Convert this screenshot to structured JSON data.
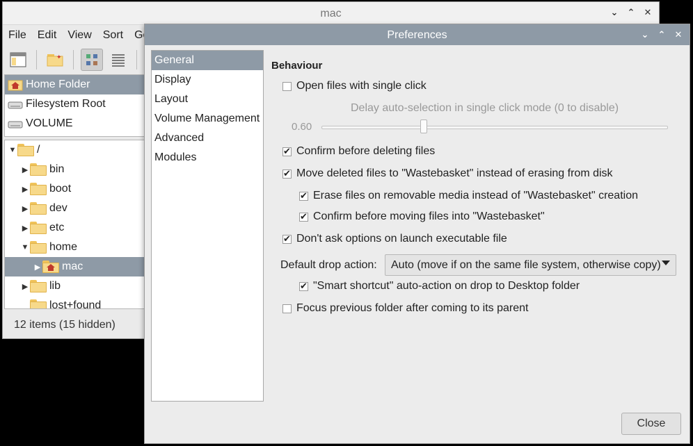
{
  "file_manager": {
    "title": "mac",
    "window_controls": {
      "minimize": "⌄",
      "maximize": "⌃",
      "close": "✕"
    },
    "menu": [
      "File",
      "Edit",
      "View",
      "Sort",
      "Go"
    ],
    "places": [
      {
        "label": "Home Folder",
        "icon": "home-icon",
        "selected": true
      },
      {
        "label": "Filesystem Root",
        "icon": "drive-icon",
        "selected": false
      },
      {
        "label": "VOLUME",
        "icon": "drive-icon",
        "selected": false
      }
    ],
    "tree": [
      {
        "label": "/",
        "expanded": true,
        "level": 0
      },
      {
        "label": "bin",
        "expanded": false,
        "level": 1
      },
      {
        "label": "boot",
        "expanded": false,
        "level": 1
      },
      {
        "label": "dev",
        "expanded": false,
        "level": 1
      },
      {
        "label": "etc",
        "expanded": false,
        "level": 1
      },
      {
        "label": "home",
        "expanded": true,
        "level": 1
      },
      {
        "label": "mac",
        "expanded": false,
        "level": 2,
        "selected": true
      },
      {
        "label": "lib",
        "expanded": false,
        "level": 1
      },
      {
        "label": "lost+found",
        "expanded": false,
        "level": 1
      }
    ],
    "status": "12 items (15 hidden)"
  },
  "preferences": {
    "title": "Preferences",
    "categories": [
      {
        "label": "General",
        "selected": true
      },
      {
        "label": "Display"
      },
      {
        "label": "Layout"
      },
      {
        "label": "Volume Management"
      },
      {
        "label": "Advanced"
      },
      {
        "label": "Modules"
      }
    ],
    "section_title": "Behaviour",
    "options": {
      "single_click": {
        "label": "Open files with single click",
        "checked": false
      },
      "delay_label": "Delay auto-selection in single click mode (0 to disable)",
      "delay_value": "0.60",
      "confirm_delete": {
        "label": "Confirm before deleting files",
        "checked": true
      },
      "wastebasket": {
        "label": "Move deleted files to \"Wastebasket\" instead of erasing from disk",
        "checked": true
      },
      "erase_removable": {
        "label": "Erase files on removable media instead of \"Wastebasket\" creation",
        "checked": true
      },
      "confirm_wastebasket": {
        "label": "Confirm before moving files into \"Wastebasket\"",
        "checked": true
      },
      "dont_ask_exec": {
        "label": "Don't ask options on launch executable file",
        "checked": true
      },
      "drop_action_label": "Default drop action:",
      "drop_action_value": "Auto (move if on the same file system, otherwise copy)",
      "smart_shortcut": {
        "label": "\"Smart shortcut\" auto-action on drop to Desktop folder",
        "checked": true
      },
      "focus_previous": {
        "label": "Focus previous folder after coming to its parent",
        "checked": false
      }
    },
    "close_label": "Close"
  },
  "colors": {
    "selection": "#8e9aa6",
    "folder": "#f7d98a"
  }
}
